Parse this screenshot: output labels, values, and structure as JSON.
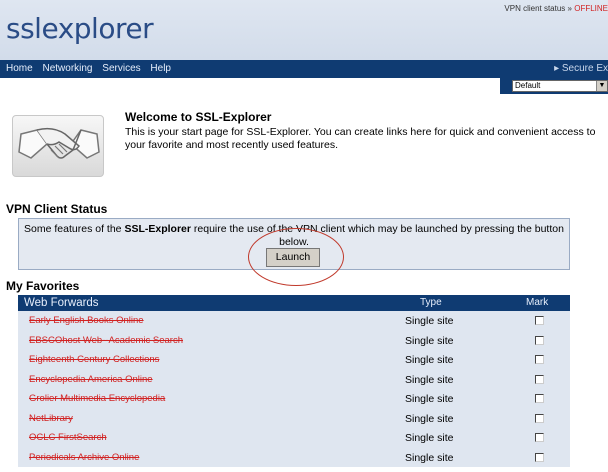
{
  "header": {
    "logo_text": "sslexplorer",
    "status_label": "VPN client status »",
    "status_value": "OFFLINE"
  },
  "nav": {
    "items": [
      "Home",
      "Networking",
      "Services",
      "Help"
    ],
    "secure_link": "▸ Secure Ex",
    "theme_select": {
      "value": "Default"
    }
  },
  "welcome": {
    "title": "Welcome to SSL-Explorer",
    "text": "This is your start page for SSL-Explorer. You can create links here for quick and convenient access to your favorite and most recently used features."
  },
  "vpn": {
    "section_title": "VPN Client Status",
    "message_prefix": "Some features of the",
    "message_brand": "SSL-Explorer",
    "message_suffix": "require the use of the VPN client which may be launched by pressing the button below.",
    "launch_label": "Launch",
    "highlight_color": "#c0392b"
  },
  "favorites": {
    "section_title": "My Favorites",
    "columns": {
      "title": "Web Forwards",
      "type": "Type",
      "mark": "Mark"
    },
    "rows": [
      {
        "name": "Early English Books Online",
        "type": "Single site",
        "checked": false
      },
      {
        "name": "EBSCOhost Web--Academic Search",
        "type": "Single site",
        "checked": false
      },
      {
        "name": "Eighteenth Century Collections",
        "type": "Single site",
        "checked": false
      },
      {
        "name": "Encyclopedia America Online",
        "type": "Single site",
        "checked": false
      },
      {
        "name": "Grolier Multimedia Encyclopedia",
        "type": "Single site",
        "checked": false
      },
      {
        "name": "NetLibrary",
        "type": "Single site",
        "checked": false
      },
      {
        "name": "OCLC FirstSearch",
        "type": "Single site",
        "checked": false
      },
      {
        "name": "Periodicals Archive Online",
        "type": "Single site",
        "checked": false
      }
    ]
  },
  "colors": {
    "nav_bg": "#0f3b72",
    "link_red": "#d12222",
    "table_bg": "#dfe6f0"
  }
}
